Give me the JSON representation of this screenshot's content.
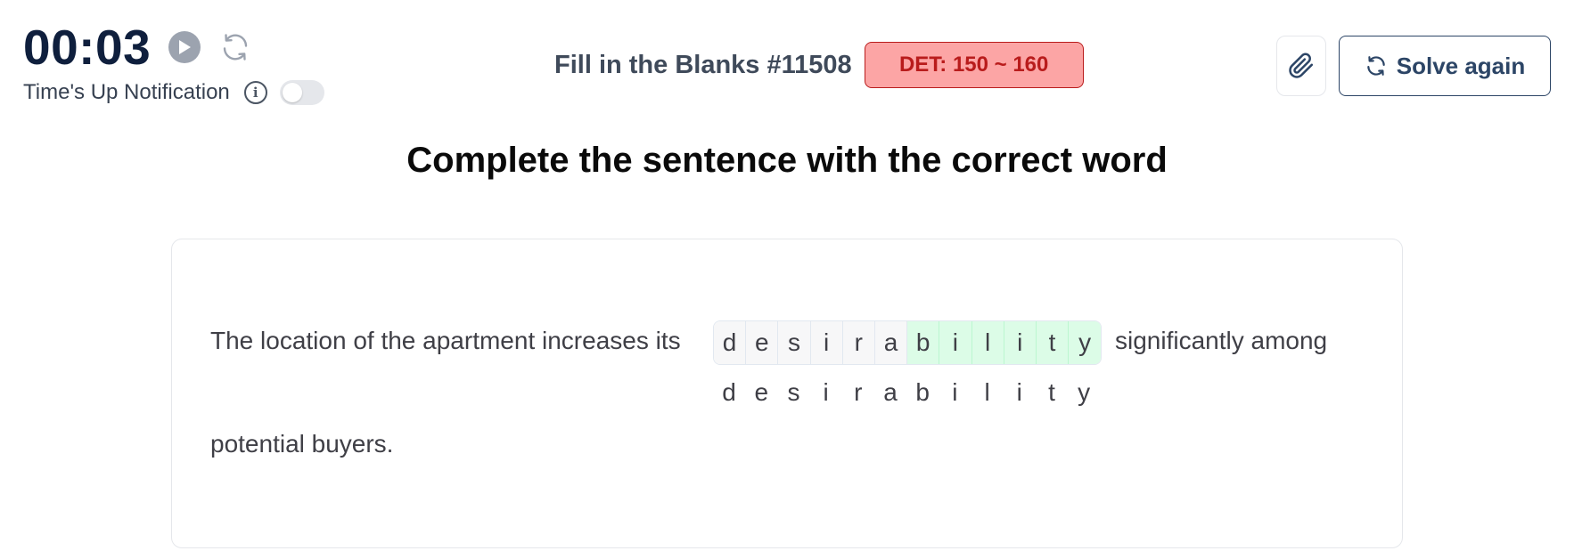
{
  "timer": {
    "display": "00:03",
    "play_icon": "play-icon",
    "reset_icon": "refresh-icon",
    "notification_label": "Time's Up Notification",
    "notification_enabled": false
  },
  "header": {
    "title": "Fill in the Blanks #11508",
    "badge": "DET: 150 ~ 160",
    "badge_color": "#fca5a5",
    "badge_text_color": "#b91c1c"
  },
  "actions": {
    "attach_icon": "paperclip-icon",
    "solve_again_label": "Solve again",
    "accent": "#2c4566"
  },
  "heading": "Complete the sentence with the correct word",
  "sentence": {
    "before": "The location of the apartment increases its",
    "after": "significantly among",
    "line2": "potential buyers.",
    "blank_letters": [
      {
        "char": "d",
        "state": "given"
      },
      {
        "char": "e",
        "state": "given"
      },
      {
        "char": "s",
        "state": "given"
      },
      {
        "char": "i",
        "state": "given"
      },
      {
        "char": "r",
        "state": "given"
      },
      {
        "char": "a",
        "state": "given"
      },
      {
        "char": "b",
        "state": "typed"
      },
      {
        "char": "i",
        "state": "typed"
      },
      {
        "char": "l",
        "state": "typed"
      },
      {
        "char": "i",
        "state": "typed"
      },
      {
        "char": "t",
        "state": "typed"
      },
      {
        "char": "y",
        "state": "typed"
      }
    ],
    "answer_letters": [
      "d",
      "e",
      "s",
      "i",
      "r",
      "a",
      "b",
      "i",
      "l",
      "i",
      "t",
      "y"
    ]
  }
}
